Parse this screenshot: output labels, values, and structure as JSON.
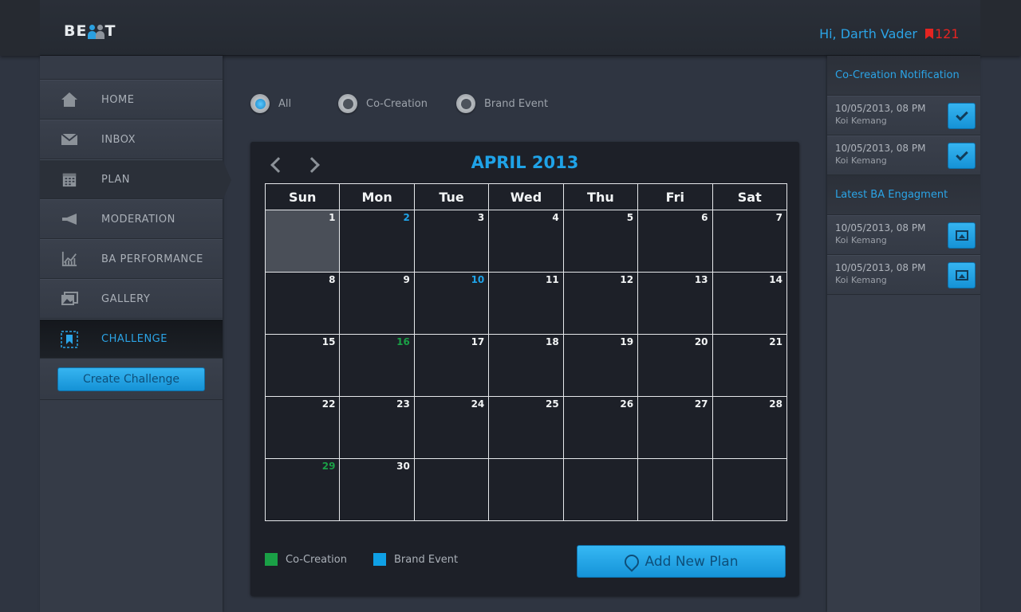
{
  "header": {
    "logo_prefix": "BE",
    "logo_suffix": "T",
    "greeting": "Hi, Darth Vader",
    "flag_count": "121"
  },
  "sidebar": {
    "items": [
      {
        "label": "HOME",
        "icon": "home-icon"
      },
      {
        "label": "INBOX",
        "icon": "envelope-icon"
      },
      {
        "label": "PLAN",
        "icon": "calendar-icon"
      },
      {
        "label": "MODERATION",
        "icon": "megaphone-icon"
      },
      {
        "label": "BA PERFORMANCE",
        "icon": "chart-icon"
      },
      {
        "label": "GALLERY",
        "icon": "gallery-icon"
      },
      {
        "label": "CHALLENGE",
        "icon": "bookmark-icon"
      }
    ],
    "create_button": "Create Challenge"
  },
  "filters": {
    "options": [
      "All",
      "Co-Creation",
      "Brand Event"
    ],
    "selected": "All"
  },
  "calendar": {
    "title": "APRIL 2013",
    "weekdays": [
      "Sun",
      "Mon",
      "Tue",
      "Wed",
      "Thu",
      "Fri",
      "Sat"
    ],
    "weeks": [
      [
        "1",
        "2",
        "3",
        "4",
        "5",
        "6",
        "7"
      ],
      [
        "8",
        "9",
        "10",
        "11",
        "12",
        "13",
        "14"
      ],
      [
        "15",
        "16",
        "17",
        "18",
        "19",
        "20",
        "21"
      ],
      [
        "22",
        "23",
        "24",
        "25",
        "26",
        "27",
        "28"
      ],
      [
        "29",
        "30",
        "",
        "",
        "",
        "",
        ""
      ]
    ],
    "today": "1",
    "brand_event_days": [
      "2",
      "10"
    ],
    "co_creation_days": [
      "16",
      "29"
    ]
  },
  "legend": {
    "co_creation": "Co-Creation",
    "brand_event": "Brand Event",
    "co_creation_color": "#1aa046",
    "brand_event_color": "#0fa0e6"
  },
  "add_plan_button": "Add New Plan",
  "right_panel": {
    "notifications_title": "Co-Creation Notification",
    "notifications": [
      {
        "date": "10/05/2013, 08 PM",
        "name": "Koi Kemang"
      },
      {
        "date": "10/05/2013, 08 PM",
        "name": "Koi Kemang"
      }
    ],
    "engagement_title": "Latest BA Engagment",
    "engagements": [
      {
        "date": "10/05/2013, 08 PM",
        "name": "Koi Kemang"
      },
      {
        "date": "10/05/2013, 08 PM",
        "name": "Koi Kemang"
      }
    ]
  },
  "colors": {
    "accent": "#1fa3e8",
    "flag": "#e52421",
    "background": "#2f3541"
  }
}
